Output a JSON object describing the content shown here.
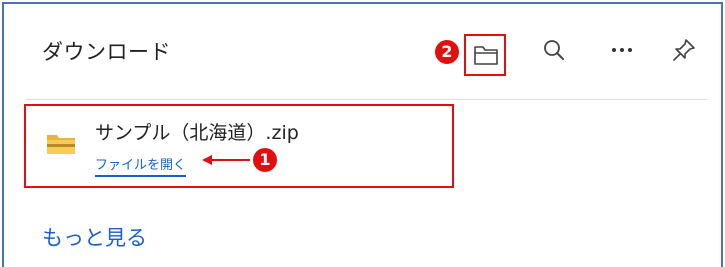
{
  "header": {
    "title": "ダウンロード"
  },
  "toolbar": {
    "icons": [
      "folder-icon",
      "search-icon",
      "more-icon",
      "pin-icon"
    ]
  },
  "annotations": {
    "badge_1": "1",
    "badge_2": "2",
    "highlight_color": "#e01010"
  },
  "download_item": {
    "file_name": "サンプル（北海道）.zip",
    "open_link": "ファイルを開く",
    "icon": "zip-folder-icon"
  },
  "footer": {
    "more_link": "もっと見る"
  },
  "colors": {
    "link": "#1a5fc8",
    "frame": "#4a72b8",
    "accent": "#e01010"
  }
}
